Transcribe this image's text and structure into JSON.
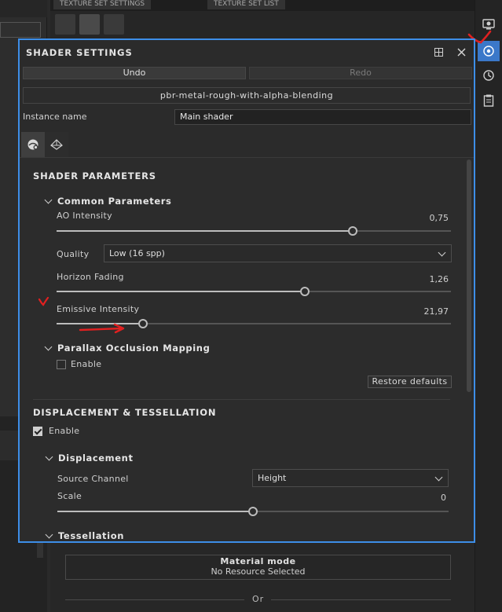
{
  "background": {
    "tabs": [
      "TEXTURE SET SETTINGS",
      "TEXTURE SET LIST"
    ],
    "material": {
      "title": "Material mode",
      "subtitle": "No Resource Selected"
    },
    "or_label": "Or"
  },
  "panel": {
    "title": "SHADER SETTINGS",
    "undo_label": "Undo",
    "redo_label": "Redo",
    "shader_name": "pbr-metal-rough-with-alpha-blending",
    "instance_label": "Instance name",
    "instance_value": "Main shader"
  },
  "shader_parameters": {
    "title": "SHADER PARAMETERS",
    "common": {
      "title": "Common Parameters",
      "ao_label": "AO Intensity",
      "ao_value": "0,75",
      "ao_fraction": 0.75,
      "quality_label": "Quality",
      "quality_value": "Low (16 spp)",
      "horizon_label": "Horizon Fading",
      "horizon_value": "1,26",
      "horizon_fraction": 0.63,
      "emissive_label": "Emissive Intensity",
      "emissive_value": "21,97",
      "emissive_fraction": 0.22
    },
    "parallax": {
      "title": "Parallax Occlusion Mapping",
      "enable_label": "Enable",
      "enabled": false
    },
    "restore_label": "Restore defaults"
  },
  "displacement": {
    "title": "DISPLACEMENT & TESSELLATION",
    "enable_label": "Enable",
    "enabled": true,
    "group_title": "Displacement",
    "source_label": "Source Channel",
    "source_value": "Height",
    "scale_label": "Scale",
    "scale_value": "0",
    "scale_fraction": 0.5,
    "tessellation_title": "Tessellation"
  },
  "colors": {
    "accent": "#3d8ee8",
    "annotation": "#e02020"
  }
}
